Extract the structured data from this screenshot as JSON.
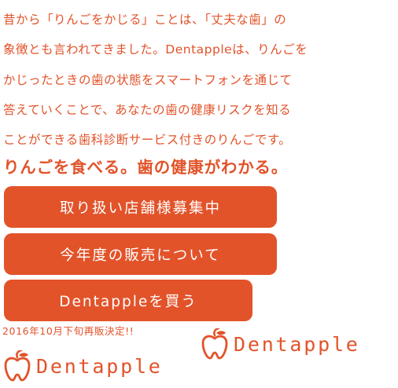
{
  "intro": {
    "lines": [
      "昔から「りんごをかじる」ことは、「丈夫な歯」の",
      "象徴とも言われてきました。Dentappleは、りんごを",
      "かじったときの歯の状態をスマートフォンを通じて",
      "答えていくことで、あなたの歯の健康リスクを知る",
      "ことができる歯科診断サービス付きのりんごです。"
    ]
  },
  "tagline": "りんごを食べる。歯の健康がわかる。",
  "buttons": {
    "recruit": "取り扱い店舗様募集中",
    "sales": "今年度の販売について",
    "buy": "Dentappleを買う"
  },
  "release_notice": "2016年10月下旬再販決定!!",
  "logo": {
    "name": "Dentapple",
    "icon": "apple-tooth-icon"
  },
  "colors": {
    "brand": "#e2532a",
    "background": "#ffffff",
    "button_text": "#ffffff"
  }
}
